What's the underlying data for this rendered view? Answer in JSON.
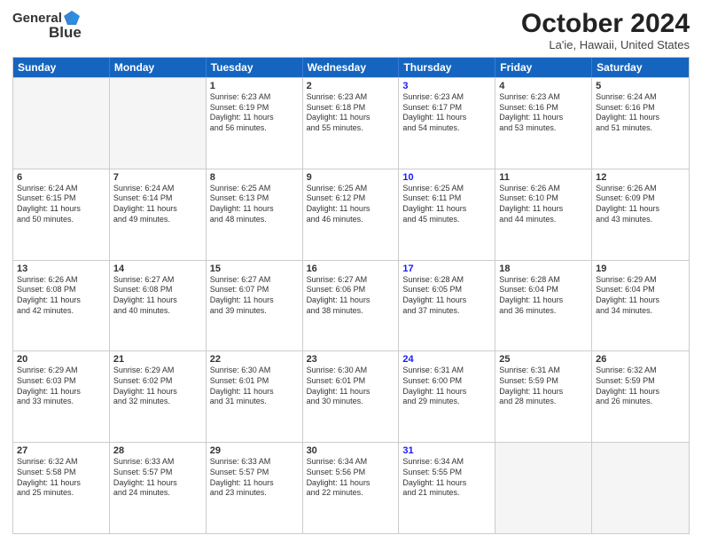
{
  "header": {
    "logo_line1": "General",
    "logo_line2": "Blue",
    "month": "October 2024",
    "location": "La'ie, Hawaii, United States"
  },
  "weekdays": [
    "Sunday",
    "Monday",
    "Tuesday",
    "Wednesday",
    "Thursday",
    "Friday",
    "Saturday"
  ],
  "rows": [
    [
      {
        "day": "",
        "lines": [],
        "empty": true
      },
      {
        "day": "",
        "lines": [],
        "empty": true
      },
      {
        "day": "1",
        "lines": [
          "Sunrise: 6:23 AM",
          "Sunset: 6:19 PM",
          "Daylight: 11 hours",
          "and 56 minutes."
        ]
      },
      {
        "day": "2",
        "lines": [
          "Sunrise: 6:23 AM",
          "Sunset: 6:18 PM",
          "Daylight: 11 hours",
          "and 55 minutes."
        ]
      },
      {
        "day": "3",
        "lines": [
          "Sunrise: 6:23 AM",
          "Sunset: 6:17 PM",
          "Daylight: 11 hours",
          "and 54 minutes."
        ],
        "thursday": true
      },
      {
        "day": "4",
        "lines": [
          "Sunrise: 6:23 AM",
          "Sunset: 6:16 PM",
          "Daylight: 11 hours",
          "and 53 minutes."
        ]
      },
      {
        "day": "5",
        "lines": [
          "Sunrise: 6:24 AM",
          "Sunset: 6:16 PM",
          "Daylight: 11 hours",
          "and 51 minutes."
        ]
      }
    ],
    [
      {
        "day": "6",
        "lines": [
          "Sunrise: 6:24 AM",
          "Sunset: 6:15 PM",
          "Daylight: 11 hours",
          "and 50 minutes."
        ]
      },
      {
        "day": "7",
        "lines": [
          "Sunrise: 6:24 AM",
          "Sunset: 6:14 PM",
          "Daylight: 11 hours",
          "and 49 minutes."
        ]
      },
      {
        "day": "8",
        "lines": [
          "Sunrise: 6:25 AM",
          "Sunset: 6:13 PM",
          "Daylight: 11 hours",
          "and 48 minutes."
        ]
      },
      {
        "day": "9",
        "lines": [
          "Sunrise: 6:25 AM",
          "Sunset: 6:12 PM",
          "Daylight: 11 hours",
          "and 46 minutes."
        ]
      },
      {
        "day": "10",
        "lines": [
          "Sunrise: 6:25 AM",
          "Sunset: 6:11 PM",
          "Daylight: 11 hours",
          "and 45 minutes."
        ],
        "thursday": true
      },
      {
        "day": "11",
        "lines": [
          "Sunrise: 6:26 AM",
          "Sunset: 6:10 PM",
          "Daylight: 11 hours",
          "and 44 minutes."
        ]
      },
      {
        "day": "12",
        "lines": [
          "Sunrise: 6:26 AM",
          "Sunset: 6:09 PM",
          "Daylight: 11 hours",
          "and 43 minutes."
        ]
      }
    ],
    [
      {
        "day": "13",
        "lines": [
          "Sunrise: 6:26 AM",
          "Sunset: 6:08 PM",
          "Daylight: 11 hours",
          "and 42 minutes."
        ]
      },
      {
        "day": "14",
        "lines": [
          "Sunrise: 6:27 AM",
          "Sunset: 6:08 PM",
          "Daylight: 11 hours",
          "and 40 minutes."
        ]
      },
      {
        "day": "15",
        "lines": [
          "Sunrise: 6:27 AM",
          "Sunset: 6:07 PM",
          "Daylight: 11 hours",
          "and 39 minutes."
        ]
      },
      {
        "day": "16",
        "lines": [
          "Sunrise: 6:27 AM",
          "Sunset: 6:06 PM",
          "Daylight: 11 hours",
          "and 38 minutes."
        ]
      },
      {
        "day": "17",
        "lines": [
          "Sunrise: 6:28 AM",
          "Sunset: 6:05 PM",
          "Daylight: 11 hours",
          "and 37 minutes."
        ],
        "thursday": true
      },
      {
        "day": "18",
        "lines": [
          "Sunrise: 6:28 AM",
          "Sunset: 6:04 PM",
          "Daylight: 11 hours",
          "and 36 minutes."
        ]
      },
      {
        "day": "19",
        "lines": [
          "Sunrise: 6:29 AM",
          "Sunset: 6:04 PM",
          "Daylight: 11 hours",
          "and 34 minutes."
        ]
      }
    ],
    [
      {
        "day": "20",
        "lines": [
          "Sunrise: 6:29 AM",
          "Sunset: 6:03 PM",
          "Daylight: 11 hours",
          "and 33 minutes."
        ]
      },
      {
        "day": "21",
        "lines": [
          "Sunrise: 6:29 AM",
          "Sunset: 6:02 PM",
          "Daylight: 11 hours",
          "and 32 minutes."
        ]
      },
      {
        "day": "22",
        "lines": [
          "Sunrise: 6:30 AM",
          "Sunset: 6:01 PM",
          "Daylight: 11 hours",
          "and 31 minutes."
        ]
      },
      {
        "day": "23",
        "lines": [
          "Sunrise: 6:30 AM",
          "Sunset: 6:01 PM",
          "Daylight: 11 hours",
          "and 30 minutes."
        ]
      },
      {
        "day": "24",
        "lines": [
          "Sunrise: 6:31 AM",
          "Sunset: 6:00 PM",
          "Daylight: 11 hours",
          "and 29 minutes."
        ],
        "thursday": true
      },
      {
        "day": "25",
        "lines": [
          "Sunrise: 6:31 AM",
          "Sunset: 5:59 PM",
          "Daylight: 11 hours",
          "and 28 minutes."
        ]
      },
      {
        "day": "26",
        "lines": [
          "Sunrise: 6:32 AM",
          "Sunset: 5:59 PM",
          "Daylight: 11 hours",
          "and 26 minutes."
        ]
      }
    ],
    [
      {
        "day": "27",
        "lines": [
          "Sunrise: 6:32 AM",
          "Sunset: 5:58 PM",
          "Daylight: 11 hours",
          "and 25 minutes."
        ]
      },
      {
        "day": "28",
        "lines": [
          "Sunrise: 6:33 AM",
          "Sunset: 5:57 PM",
          "Daylight: 11 hours",
          "and 24 minutes."
        ]
      },
      {
        "day": "29",
        "lines": [
          "Sunrise: 6:33 AM",
          "Sunset: 5:57 PM",
          "Daylight: 11 hours",
          "and 23 minutes."
        ]
      },
      {
        "day": "30",
        "lines": [
          "Sunrise: 6:34 AM",
          "Sunset: 5:56 PM",
          "Daylight: 11 hours",
          "and 22 minutes."
        ]
      },
      {
        "day": "31",
        "lines": [
          "Sunrise: 6:34 AM",
          "Sunset: 5:55 PM",
          "Daylight: 11 hours",
          "and 21 minutes."
        ],
        "thursday": true
      },
      {
        "day": "",
        "lines": [],
        "empty": true
      },
      {
        "day": "",
        "lines": [],
        "empty": true
      }
    ]
  ]
}
